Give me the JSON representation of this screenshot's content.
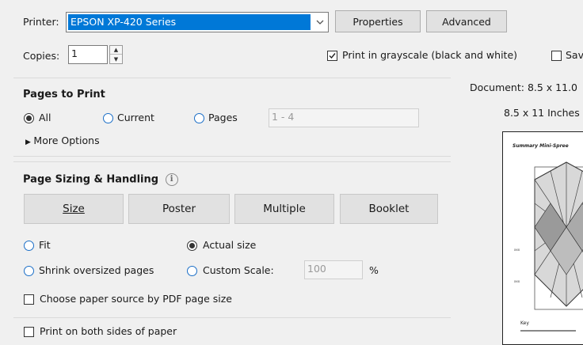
{
  "printer": {
    "label": "Printer:",
    "selected": "EPSON XP-420 Series",
    "properties_label": "Properties",
    "advanced_label": "Advanced"
  },
  "copies": {
    "label": "Copies:",
    "value": "1"
  },
  "options": {
    "grayscale_label": "Print in grayscale (black and white)",
    "grayscale_checked": true,
    "save_label": "Sav",
    "save_checked": false
  },
  "pages_to_print": {
    "title": "Pages to Print",
    "all_label": "All",
    "current_label": "Current",
    "pages_label": "Pages",
    "pages_range": "1 - 4",
    "selected": "All",
    "more_options_label": "More Options"
  },
  "sizing": {
    "title": "Page Sizing & Handling",
    "buttons": [
      "Size",
      "Poster",
      "Multiple",
      "Booklet"
    ],
    "fit_label": "Fit",
    "actual_label": "Actual size",
    "shrink_label": "Shrink oversized pages",
    "custom_label": "Custom Scale:",
    "scale_value": "100",
    "percent": "%",
    "selected": "Actual size",
    "paper_source_label": "Choose paper source by PDF page size",
    "both_sides_label": "Print on both sides of paper"
  },
  "preview": {
    "document_label": "Document: 8.5 x 11.0",
    "size_label": "8.5 x 11 Inches",
    "page_heading": "Summary Mini-Spree",
    "key_label": "Key"
  },
  "colors": {
    "selection": "#0078d7",
    "background": "#f0f0f0"
  }
}
